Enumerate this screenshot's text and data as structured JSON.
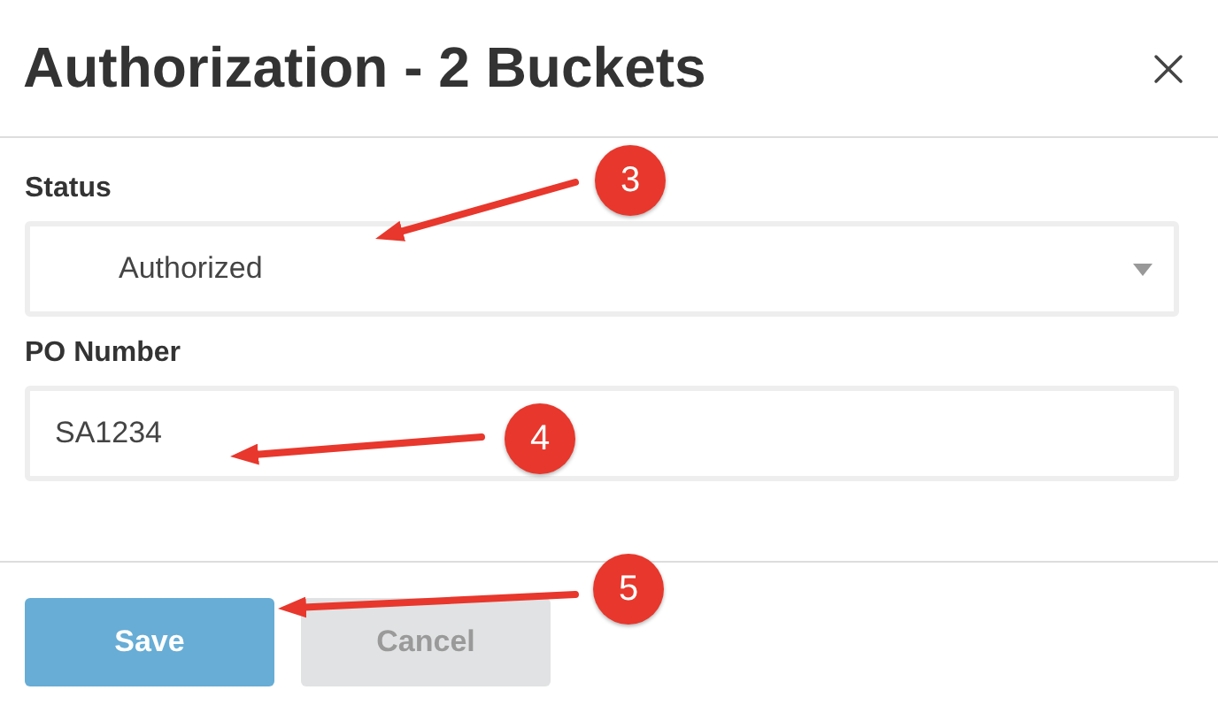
{
  "dialog": {
    "title": "Authorization - 2 Buckets"
  },
  "fields": [
    {
      "kind": "select",
      "label": "Status",
      "value": "Authorized"
    },
    {
      "kind": "text",
      "label": "PO Number",
      "value": "SA1234"
    }
  ],
  "buttons": [
    {
      "label": "Save",
      "kind": "primary",
      "disabled": false
    },
    {
      "label": "Cancel",
      "kind": "secondary",
      "disabled": true
    }
  ],
  "annotations": [
    {
      "number": "3"
    },
    {
      "number": "4"
    },
    {
      "number": "5"
    }
  ]
}
